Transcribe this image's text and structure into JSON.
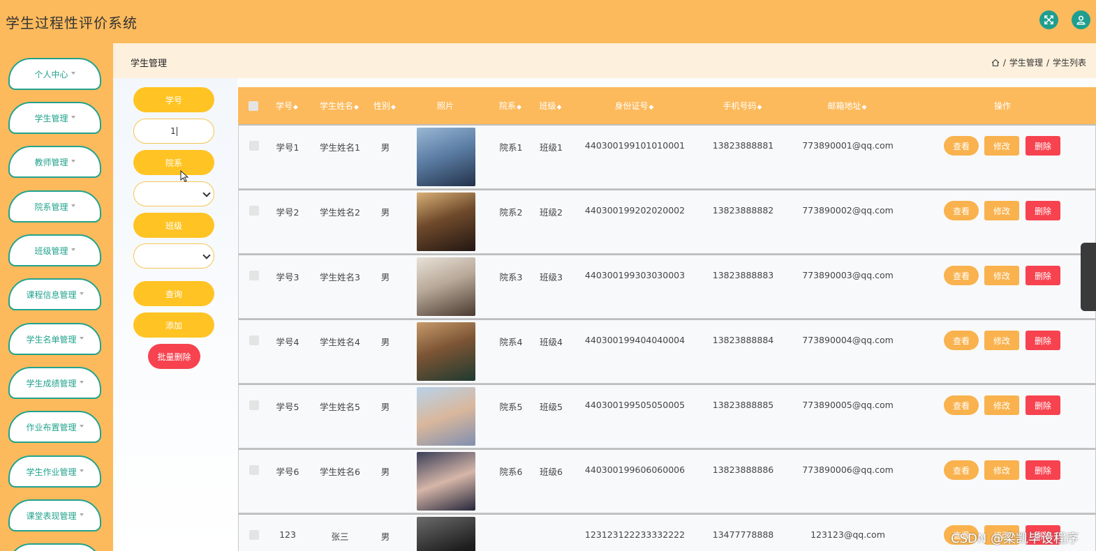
{
  "app": {
    "title": "学生过程性评价系统"
  },
  "sidebar": {
    "items": [
      {
        "label": "个人中心"
      },
      {
        "label": "学生管理"
      },
      {
        "label": "教师管理"
      },
      {
        "label": "院系管理"
      },
      {
        "label": "班级管理"
      },
      {
        "label": "课程信息管理"
      },
      {
        "label": "学生名单管理"
      },
      {
        "label": "学生成绩管理"
      },
      {
        "label": "作业布置管理"
      },
      {
        "label": "学生作业管理"
      },
      {
        "label": "课堂表现管理"
      }
    ]
  },
  "page": {
    "title": "学生管理",
    "breadcrumb": [
      "学生管理",
      "学生列表"
    ],
    "separator": "/"
  },
  "search": {
    "xuehao_label": "学号",
    "xuehao_value": "1",
    "yuanxi_label": "院系",
    "banji_label": "班级",
    "query_label": "查询",
    "add_label": "添加",
    "batch_delete_label": "批量删除"
  },
  "table": {
    "columns": [
      "学号",
      "学生姓名",
      "性别",
      "照片",
      "院系",
      "班级",
      "身份证号",
      "手机号码",
      "邮箱地址",
      "操作"
    ],
    "sort_glyph": "◆",
    "rows": [
      {
        "xuehao": "学号1",
        "name": "学生姓名1",
        "gender": "男",
        "yuanxi": "院系1",
        "banji": "班级1",
        "idcard": "440300199101010001",
        "phone": "13823888881",
        "email": "773890001@qq.com",
        "photo_color": "#6c8fb3"
      },
      {
        "xuehao": "学号2",
        "name": "学生姓名2",
        "gender": "男",
        "yuanxi": "院系2",
        "banji": "班级2",
        "idcard": "440300199202020002",
        "phone": "13823888882",
        "email": "773890002@qq.com",
        "photo_color": "#8a6a45"
      },
      {
        "xuehao": "学号3",
        "name": "学生姓名3",
        "gender": "男",
        "yuanxi": "院系3",
        "banji": "班级3",
        "idcard": "440300199303030003",
        "phone": "13823888883",
        "email": "773890003@qq.com",
        "photo_color": "#c9bfb2"
      },
      {
        "xuehao": "学号4",
        "name": "学生姓名4",
        "gender": "男",
        "yuanxi": "院系4",
        "banji": "班级4",
        "idcard": "440300199404040004",
        "phone": "13823888884",
        "email": "773890004@qq.com",
        "photo_color": "#a2764e"
      },
      {
        "xuehao": "学号5",
        "name": "学生姓名5",
        "gender": "男",
        "yuanxi": "院系5",
        "banji": "班级5",
        "idcard": "440300199505050005",
        "phone": "13823888885",
        "email": "773890005@qq.com",
        "photo_color": "#a9c7e0"
      },
      {
        "xuehao": "学号6",
        "name": "学生姓名6",
        "gender": "男",
        "yuanxi": "院系6",
        "banji": "班级6",
        "idcard": "440300199606060006",
        "phone": "13823888886",
        "email": "773890006@qq.com",
        "photo_color": "#35384a"
      },
      {
        "xuehao": "123",
        "name": "张三",
        "gender": "男",
        "yuanxi": "",
        "banji": "",
        "idcard": "123123122233332222",
        "phone": "13477778888",
        "email": "123123@qq.com",
        "photo_color": "#3b3b3b"
      }
    ],
    "actions": {
      "view": "查看",
      "edit": "修改",
      "delete": "删除"
    }
  },
  "overlay": {
    "watermark": "CSDN @梁凯毕设程序"
  },
  "colors": {
    "header": "#fcba5c",
    "accent_green": "#22a28d",
    "button_yellow": "#ffc323",
    "danger": "#f7424f"
  },
  "icons": [
    "fullscreen-icon",
    "user-icon",
    "home-icon",
    "chevron-down-icon",
    "sort-icon",
    "checkbox-icon"
  ]
}
